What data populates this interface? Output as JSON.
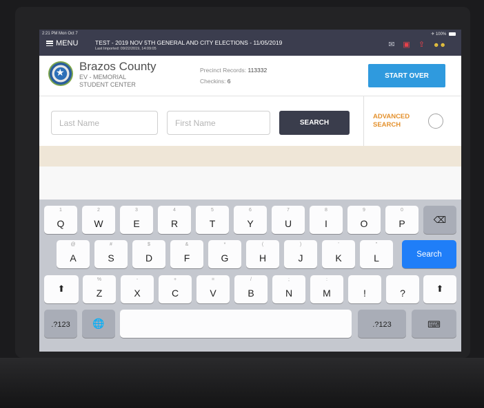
{
  "status_bar": {
    "time_date": "2:21 PM  Mon Oct 7",
    "battery": "100%"
  },
  "header": {
    "menu_label": "MENU",
    "title": "TEST - 2019 NOV 5TH GENERAL AND CITY ELECTIONS - 11/05/2019",
    "last_imported": "Last Imported: 09/22/2019, 14:09:05"
  },
  "county": {
    "name": "Brazos County",
    "location_line1": "EV - MEMORIAL",
    "location_line2": "STUDENT CENTER",
    "precinct_label": "Precinct Records:",
    "precinct_value": "113332",
    "checkins_label": "Checkins:",
    "checkins_value": "6",
    "start_over_label": "START OVER"
  },
  "search": {
    "last_name_placeholder": "Last Name",
    "first_name_placeholder": "First Name",
    "search_label": "SEARCH",
    "advanced_line1": "ADVANCED",
    "advanced_line2": "SEARCH"
  },
  "keyboard": {
    "row1": [
      {
        "alt": "1",
        "main": "Q"
      },
      {
        "alt": "2",
        "main": "W"
      },
      {
        "alt": "3",
        "main": "E"
      },
      {
        "alt": "4",
        "main": "R"
      },
      {
        "alt": "5",
        "main": "T"
      },
      {
        "alt": "6",
        "main": "Y"
      },
      {
        "alt": "7",
        "main": "U"
      },
      {
        "alt": "8",
        "main": "I"
      },
      {
        "alt": "9",
        "main": "O"
      },
      {
        "alt": "0",
        "main": "P"
      }
    ],
    "row2": [
      {
        "alt": "@",
        "main": "A"
      },
      {
        "alt": "#",
        "main": "S"
      },
      {
        "alt": "$",
        "main": "D"
      },
      {
        "alt": "&",
        "main": "F"
      },
      {
        "alt": "*",
        "main": "G"
      },
      {
        "alt": "(",
        "main": "H"
      },
      {
        "alt": ")",
        "main": "J"
      },
      {
        "alt": "'",
        "main": "K"
      },
      {
        "alt": "\"",
        "main": "L"
      }
    ],
    "row3": [
      {
        "alt": "%",
        "main": "Z"
      },
      {
        "alt": "-",
        "main": "X"
      },
      {
        "alt": "+",
        "main": "C"
      },
      {
        "alt": "=",
        "main": "V"
      },
      {
        "alt": "/",
        "main": "B"
      },
      {
        "alt": ";",
        "main": "N"
      },
      {
        "alt": ":",
        "main": "M"
      },
      {
        "alt": "",
        "main": "!"
      },
      {
        "alt": "",
        "main": "?"
      }
    ],
    "search_key": "Search",
    "numbers_key": ".?123"
  }
}
